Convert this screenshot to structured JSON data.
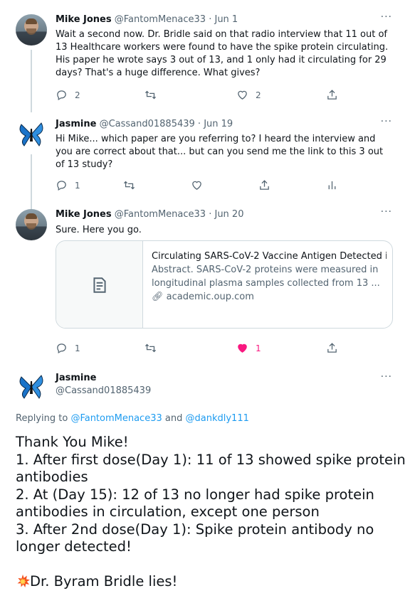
{
  "tweets": [
    {
      "name": "Mike Jones",
      "handle": "@FantomMenace33",
      "dot": "·",
      "date": "Jun 1",
      "more": "···",
      "text": "Wait a second now.  Dr. Bridle said on that radio interview that 11 out of 13 Healthcare workers were found to have the spike protein circulating.  His paper he wrote says 3 out of 13, and 1 only had it circulating for 29 days? That's a huge difference. What gives?",
      "replies": "2",
      "retweets": "",
      "likes": "2"
    },
    {
      "name": "Jasmine",
      "handle": "@Cassand01885439",
      "dot": "·",
      "date": "Jun 19",
      "more": "···",
      "text": "Hi Mike... which paper are you referring to? I heard the interview and you are correct about that... but can you send me the link to this 3 out of 13 study?",
      "replies": "1",
      "retweets": "",
      "likes": ""
    },
    {
      "name": "Mike Jones",
      "handle": "@FantomMenace33",
      "dot": "·",
      "date": "Jun 20",
      "more": "···",
      "text": "Sure.  Here you go.",
      "card": {
        "title": "Circulating SARS-CoV-2 Vaccine Antigen Detected i...",
        "description": "Abstract. SARS-CoV-2 proteins were measured in longitudinal plasma samples collected from 13 ...",
        "domain": "academic.oup.com"
      },
      "replies": "1",
      "retweets": "",
      "likes": "1"
    }
  ],
  "main_tweet": {
    "name": "Jasmine",
    "handle": "@Cassand01885439",
    "more": "···",
    "replying_prefix": "Replying to",
    "replying_user1": "@FantomMenace33",
    "replying_and": "and",
    "replying_user2": "@dankdly111",
    "lines": [
      "Thank You Mike!",
      "1. After first dose(Day 1): 11 of 13 showed spike protein antibodies",
      "2. At (Day 15): 12 of 13 no longer had spike protein antibodies in circulation, except one person",
      "3. After 2nd dose(Day 1): Spike protein antibody no longer detected!",
      "Dr. Byram Bridle lies!"
    ]
  },
  "colors": {
    "text": "#0f1419",
    "secondary": "#536471",
    "link": "#1d9bf0",
    "like": "#f91880",
    "border": "#cfd9de"
  }
}
